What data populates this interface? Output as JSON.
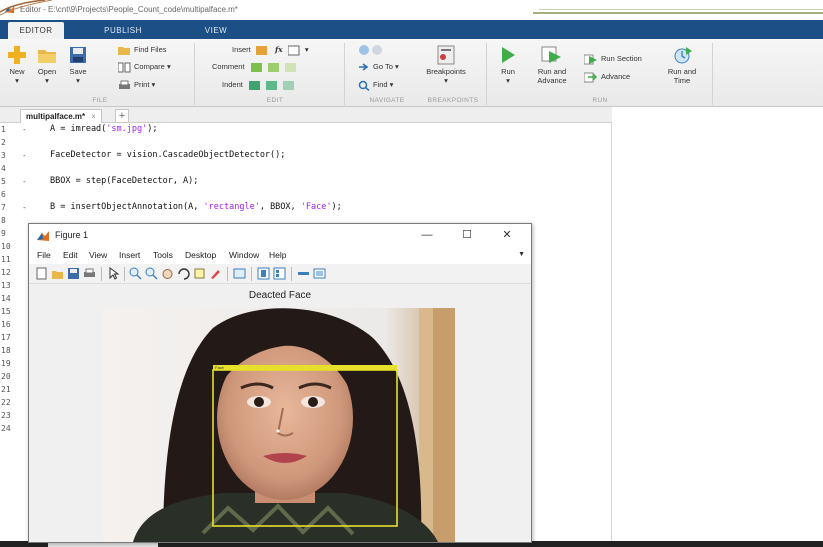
{
  "window": {
    "title": "Editor - E:\\cnt\\9\\Projects\\People_Count_code\\multipalface.m*"
  },
  "ribbon_tabs": [
    "EDITOR",
    "PUBLISH",
    "VIEW"
  ],
  "ribbon": {
    "new": "New",
    "open": "Open",
    "save": "Save",
    "find_files": "Find Files",
    "compare": "Compare",
    "print": "Print",
    "insert": "Insert",
    "comment": "Comment",
    "indent": "Indent",
    "fx": "fx",
    "go_to": "Go To",
    "find": "Find",
    "breakpoints": "Breakpoints",
    "run": "Run",
    "run_and_advance_1": "Run and",
    "run_and_advance_2": "Advance",
    "run_section": "Run Section",
    "advance": "Advance",
    "run_and_time_1": "Run and",
    "run_and_time_2": "Time",
    "sections": [
      "FILE",
      "EDIT",
      "NAVIGATE",
      "BREAKPOINTS",
      "RUN"
    ]
  },
  "editor": {
    "file_tab": "multipalface.m*",
    "close_symbol": "×",
    "plus_symbol": "+",
    "line_numbers": [
      "1",
      "2",
      "3",
      "4",
      "5",
      "6",
      "7",
      "8",
      "9",
      "10",
      "11",
      "12",
      "13",
      "14",
      "15",
      "16",
      "17",
      "18",
      "19",
      "20",
      "21",
      "22",
      "23",
      "24"
    ],
    "dash": "-",
    "code": {
      "l1_a": "A = imread(",
      "l1_s": "'sm.jpg'",
      "l1_b": ");",
      "l3": "FaceDetector = vision.CascadeObjectDetector();",
      "l5": "BBOX = step(FaceDetector, A);",
      "l7_a": "B = insertObjectAnnotation(A, ",
      "l7_s1": "'rectangle'",
      "l7_b": ", BBOX, ",
      "l7_s2": "'Face'",
      "l7_c": ");"
    }
  },
  "figure": {
    "title": "Figure 1",
    "minimize": "—",
    "maximize": "☐",
    "close": "✕",
    "menu": [
      "File",
      "Edit",
      "View",
      "Insert",
      "Tools",
      "Desktop",
      "Window",
      "Help"
    ],
    "menu_arrow": "▼",
    "axes_title": "Deacted Face",
    "annotation_label": "Face"
  },
  "colors": {
    "ribbon_tab_bar": "#1b4f86",
    "string": "#a020f0",
    "annotation": "#e6e02a"
  }
}
